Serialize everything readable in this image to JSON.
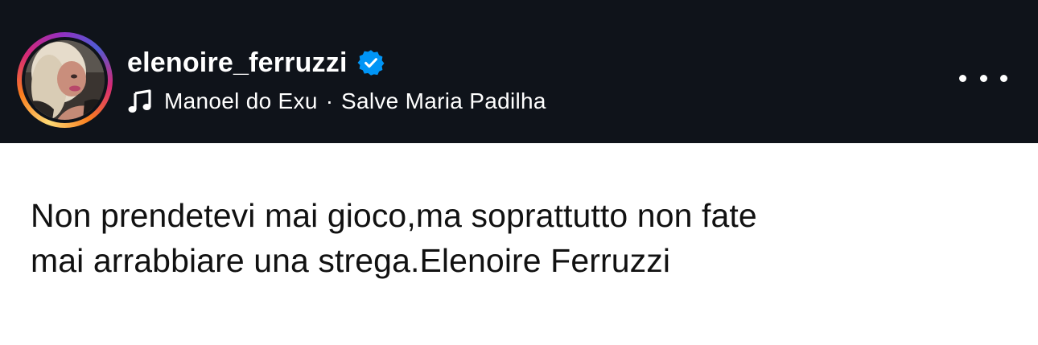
{
  "post": {
    "username": "elenoire_ferruzzi",
    "verified": true,
    "audio": {
      "artist": "Manoel do Exu",
      "separator": "·",
      "track": "Salve Maria Padilha"
    },
    "more_label": "•••",
    "caption_lines": [
      "Non prendetevi mai gioco,ma soprattutto non fate",
      "mai arrabbiare una strega.Elenoire Ferruzzi"
    ]
  },
  "icons": {
    "verified": "verified-badge-icon",
    "audio": "music-note-icon",
    "more": "more-options-icon"
  },
  "colors": {
    "header_bg": "#0f131a",
    "verified_blue": "#0095f6",
    "story_ring": [
      "#feda75",
      "#fa7e1e",
      "#d62976",
      "#962fbf",
      "#4f5bd5"
    ]
  }
}
